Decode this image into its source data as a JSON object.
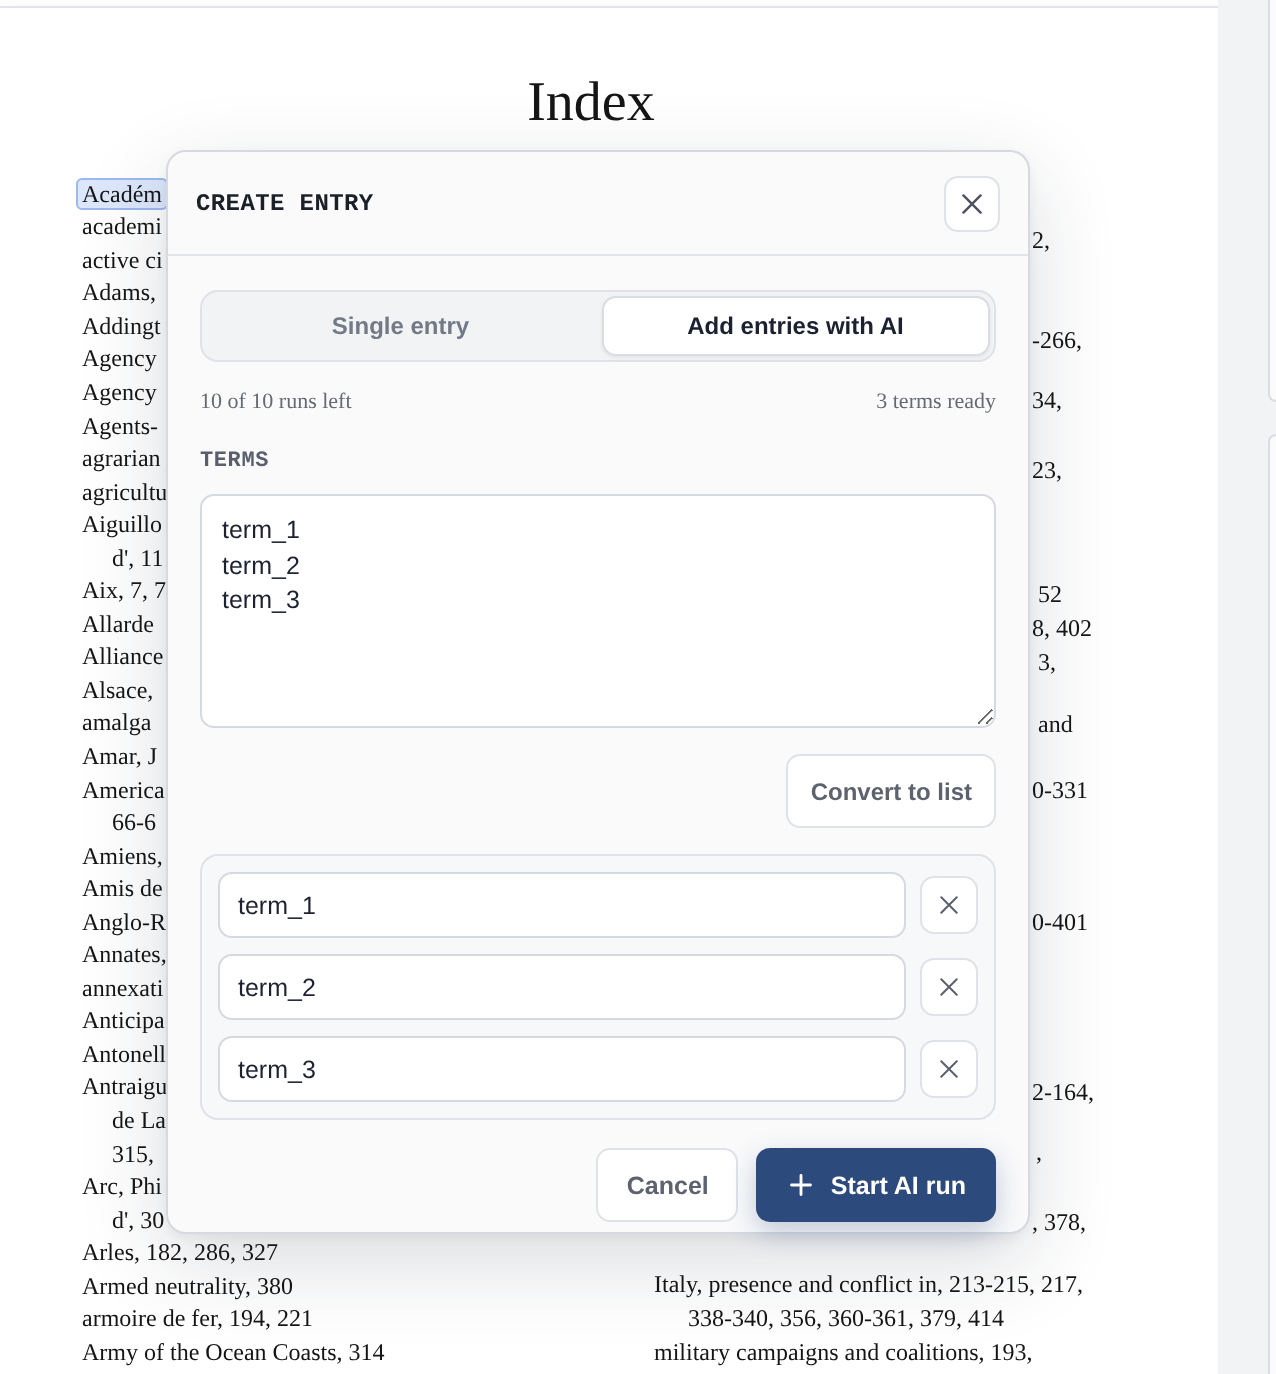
{
  "document": {
    "title": "Index",
    "left_column": [
      {
        "lines": [
          "Académ"
        ],
        "highlighted": true
      },
      {
        "lines": [
          "academi"
        ],
        "highlighted": false
      },
      {
        "lines": [
          "active ci"
        ],
        "highlighted": false
      },
      {
        "lines": [
          "Adams,"
        ],
        "highlighted": false
      },
      {
        "lines": [
          "Addingt"
        ],
        "highlighted": false
      },
      {
        "lines": [
          "Agency"
        ],
        "highlighted": false
      },
      {
        "lines": [
          "Agency"
        ],
        "highlighted": false
      },
      {
        "lines": [
          "Agents-"
        ],
        "highlighted": false
      },
      {
        "lines": [
          "agrarian"
        ],
        "highlighted": false
      },
      {
        "lines": [
          "agricultu"
        ],
        "highlighted": false
      },
      {
        "lines": [
          "Aiguillo",
          "d', 11"
        ],
        "highlighted": false
      },
      {
        "lines": [
          "Aix, 7, 7"
        ],
        "highlighted": false
      },
      {
        "lines": [
          "Allarde"
        ],
        "highlighted": false
      },
      {
        "lines": [
          "Alliance"
        ],
        "highlighted": false
      },
      {
        "lines": [
          "Alsace,"
        ],
        "highlighted": false
      },
      {
        "lines": [
          "amalga"
        ],
        "highlighted": false
      },
      {
        "lines": [
          "Amar, J"
        ],
        "highlighted": false
      },
      {
        "lines": [
          "America",
          "66-6"
        ],
        "highlighted": false
      },
      {
        "lines": [
          "Amiens,"
        ],
        "highlighted": false
      },
      {
        "lines": [
          "Amis de"
        ],
        "highlighted": false
      },
      {
        "lines": [
          "Anglo-R"
        ],
        "highlighted": false
      },
      {
        "lines": [
          "Annates,"
        ],
        "highlighted": false
      },
      {
        "lines": [
          "annexati"
        ],
        "highlighted": false
      },
      {
        "lines": [
          "Anticipa"
        ],
        "highlighted": false
      },
      {
        "lines": [
          "Antonell"
        ],
        "highlighted": false
      },
      {
        "lines": [
          "Antraigu",
          "de La",
          "315,"
        ],
        "highlighted": false
      },
      {
        "lines": [
          "Arc, Phi",
          "d', 30"
        ],
        "highlighted": false
      },
      {
        "lines": [
          "Arles, 182, 286, 327"
        ],
        "highlighted": false
      },
      {
        "lines": [
          "Armed neutrality, 380"
        ],
        "highlighted": false
      },
      {
        "lines": [
          "armoire de fer, 194, 221"
        ],
        "highlighted": false
      },
      {
        "lines": [
          "Army of the Ocean Coasts, 314"
        ],
        "highlighted": false
      }
    ],
    "right_column_fragments": [
      "2,",
      "-266,",
      "34,",
      "23,",
      "52",
      "8, 402",
      "3,",
      "and",
      "0-331",
      "0-401",
      "2-164,",
      ",",
      ", 378,"
    ],
    "right_column": [
      {
        "lines": [
          "Italy, presence and conflict in, 213-215, 217,",
          "338-340, 356, 360-361, 379, 414"
        ]
      },
      {
        "lines": [
          "military campaigns and coalitions, 193,"
        ]
      }
    ]
  },
  "dialog": {
    "title": "CREATE ENTRY",
    "tabs": [
      {
        "label": "Single entry",
        "selected": false
      },
      {
        "label": "Add entries with AI",
        "selected": true
      }
    ],
    "runs_left": "10 of 10 runs left",
    "terms_ready": "3 terms ready",
    "terms_label": "TERMS",
    "terms_text": "term_1\nterm_2\nterm_3",
    "convert_button": "Convert to list",
    "terms": [
      "term_1",
      "term_2",
      "term_3"
    ],
    "buttons": [
      {
        "kind": "secondary",
        "label": "Cancel"
      },
      {
        "kind": "primary",
        "label": "Start AI run"
      }
    ]
  }
}
